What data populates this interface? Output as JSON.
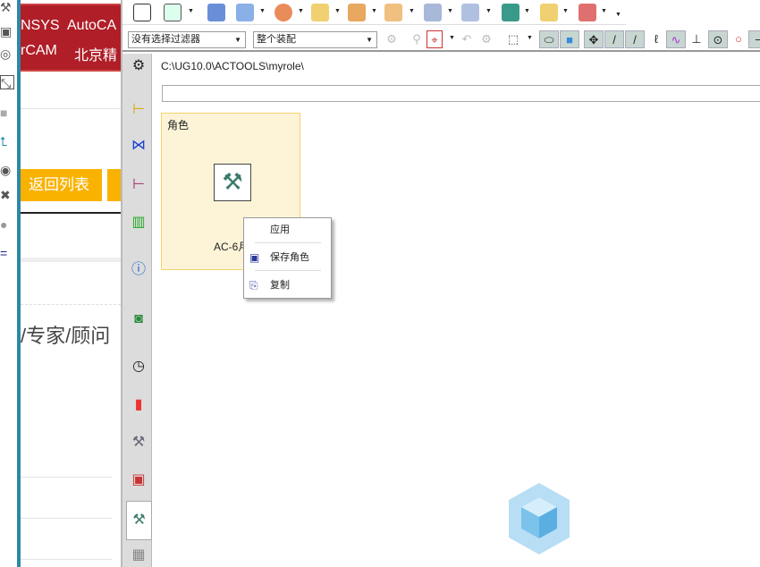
{
  "web": {
    "banner_row1": [
      "NSYS",
      "AutoCA"
    ],
    "banner_row2": [
      "rCAM",
      "北京精"
    ],
    "back_button": "返回列表",
    "body_text": "/专家/顾问"
  },
  "toolbar": {
    "filter_select": "没有选择过滤器",
    "scope_select": "整个装配"
  },
  "resource_bar": {
    "icons": [
      "settings-icon",
      "assembly-navigator-icon",
      "constraint-navigator-icon",
      "part-navigator-icon",
      "reuse-library-icon",
      "hd3d-tools-icon",
      "web-browser-icon",
      "history-icon",
      "visualization-icon",
      "process-studio-icon",
      "system-materials-icon",
      "roles-icon",
      "spreadsheet-icon"
    ]
  },
  "main": {
    "path": "C:\\UG10.0\\ACTOOLS\\myrole\\",
    "path_input": "",
    "tile": {
      "title": "角色",
      "name": "AC-6月"
    }
  },
  "context_menu": {
    "items": [
      "应用",
      "保存角色",
      "复制"
    ]
  },
  "colors": {
    "banner": "#b01e28",
    "button": "#f9b200",
    "tile_bg": "#fdf4d8",
    "teal": "#2e88a5"
  }
}
